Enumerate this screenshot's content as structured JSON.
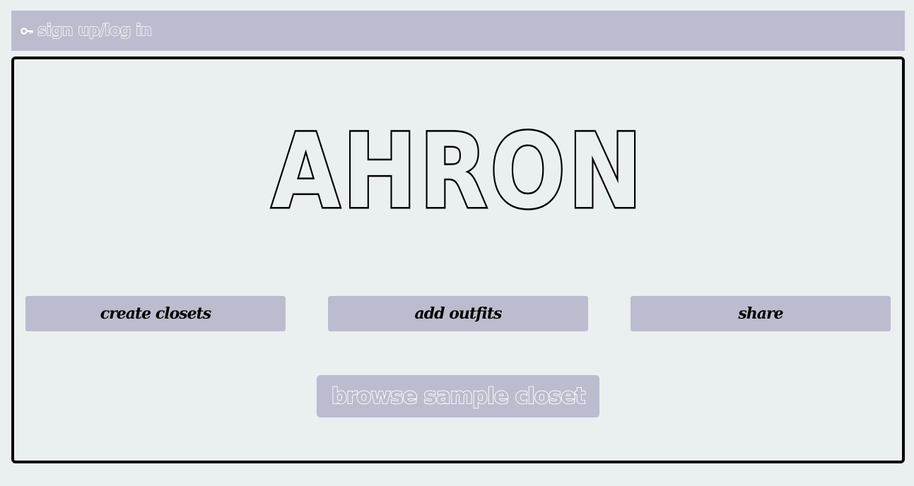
{
  "header": {
    "login_label": "sign up/log in",
    "login_icon": "key-icon"
  },
  "hero": {
    "logo_text": "AHRON"
  },
  "features": [
    {
      "label": "create closets"
    },
    {
      "label": "add outfits"
    },
    {
      "label": "share"
    }
  ],
  "actions": {
    "browse_label": "browse sample closet"
  },
  "colors": {
    "background": "#eaeff0",
    "accent": "#bbbdce",
    "border": "#000000",
    "outline_text": "#ffffff"
  }
}
